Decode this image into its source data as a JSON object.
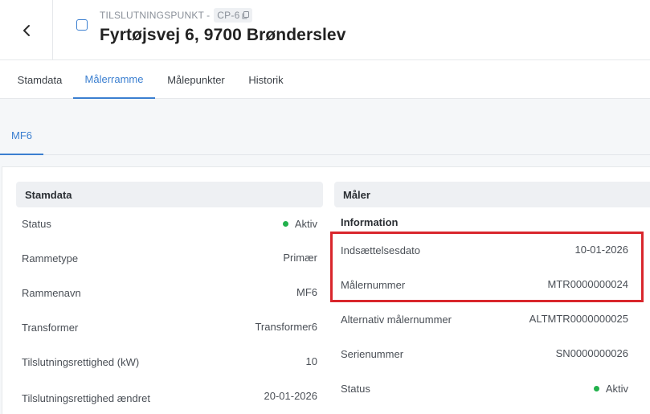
{
  "header": {
    "overline": "TILSLUTNINGSPUNKT",
    "dash": "-",
    "cp_id": "CP-6",
    "title": "Fyrtøjsvej 6, 9700 Brønderslev",
    "icons": {
      "back": "chevron-left-icon",
      "copy": "copy-icon",
      "checkbox": "checkbox-icon"
    }
  },
  "tabs": [
    {
      "label": "Stamdata"
    },
    {
      "label": "Målerramme"
    },
    {
      "label": "Målepunkter"
    },
    {
      "label": "Historik"
    }
  ],
  "active_tab": "Målerramme",
  "subtab": {
    "label": "MF6"
  },
  "stamdata": {
    "title": "Stamdata",
    "rows": [
      {
        "label": "Status",
        "value": "Aktiv"
      },
      {
        "label": "Rammetype",
        "value": "Primær"
      },
      {
        "label": "Rammenavn",
        "value": "MF6"
      },
      {
        "label": "Transformer",
        "value": "Transformer6"
      },
      {
        "label": "Tilslutningsrettighed (kW)",
        "value": "10"
      },
      {
        "label": "Tilslutningsrettighed ændret",
        "value": "20-01-2026"
      }
    ]
  },
  "maaler": {
    "title": "Måler",
    "section": "Information",
    "rows": [
      {
        "label": "Indsættelsesdato",
        "value": "10-01-2026"
      },
      {
        "label": "Målernummer",
        "value": "MTR0000000024"
      },
      {
        "label": "Alternativ målernummer",
        "value": "ALTMTR0000000025"
      },
      {
        "label": "Serienummer",
        "value": "SN0000000026"
      },
      {
        "label": "Status",
        "value": "Aktiv"
      }
    ]
  },
  "colors": {
    "accent": "#3b7fd0",
    "status_active": "#22b14c",
    "highlight": "#d9262c"
  }
}
